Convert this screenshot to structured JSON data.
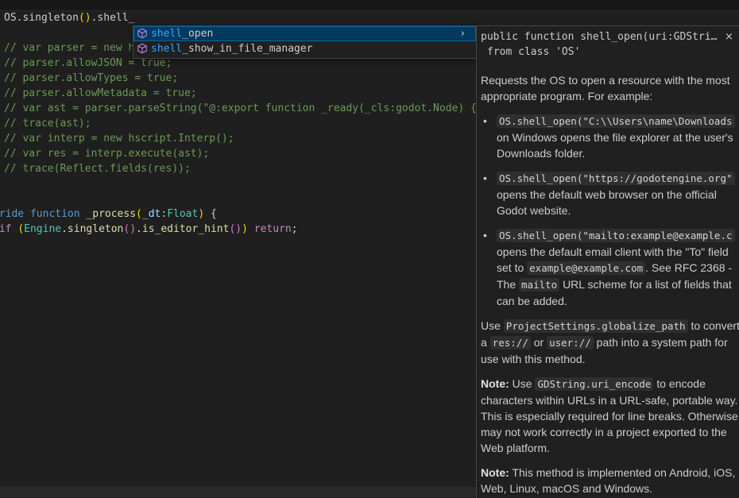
{
  "editor": {
    "lines": [
      [
        {
          "t": "OS",
          "c": "plain"
        },
        {
          "t": ".singleton",
          "c": "plain"
        },
        {
          "t": "()",
          "c": "p1"
        },
        {
          "t": ".shell_",
          "c": "plain"
        }
      ],
      [],
      [
        {
          "t": "// var parser = new h",
          "c": "cm"
        }
      ],
      [
        {
          "t": "// parser.allowJSON = true;",
          "c": "cm"
        }
      ],
      [
        {
          "t": "// parser.allowTypes = true;",
          "c": "cm"
        }
      ],
      [
        {
          "t": "// parser.allowMetadata = true;",
          "c": "cm"
        }
      ],
      [
        {
          "t": "// var ast = parser.parseString(\"@:export function _ready(_cls:godot.Node) {t",
          "c": "cm"
        }
      ],
      [
        {
          "t": "// trace(ast);",
          "c": "cm"
        }
      ],
      [
        {
          "t": "// var interp = new hscript.Interp();",
          "c": "cm"
        }
      ],
      [
        {
          "t": "// var res = interp.execute(ast);",
          "c": "cm"
        }
      ],
      [
        {
          "t": "// trace(Reflect.fields(res));",
          "c": "cm"
        }
      ],
      [],
      [],
      [
        {
          "t": "rride ",
          "c": "kw"
        },
        {
          "t": "function ",
          "c": "kw"
        },
        {
          "t": "_process",
          "c": "fn"
        },
        {
          "t": "(",
          "c": "p1"
        },
        {
          "t": "_dt",
          "c": "pm"
        },
        {
          "t": ":",
          "c": "plain"
        },
        {
          "t": "Float",
          "c": "ty"
        },
        {
          "t": ")",
          "c": "p1"
        },
        {
          "t": " {",
          "c": "plain"
        }
      ],
      [
        {
          "t": " if ",
          "c": "ctl"
        },
        {
          "t": "(",
          "c": "p1"
        },
        {
          "t": "Engine",
          "c": "ty"
        },
        {
          "t": ".singleton",
          "c": "fn"
        },
        {
          "t": "()",
          "c": "p2"
        },
        {
          "t": ".is_editor_hint",
          "c": "fn"
        },
        {
          "t": "()",
          "c": "p2"
        },
        {
          "t": ")",
          "c": "p1"
        },
        {
          "t": " return",
          "c": "ctl"
        },
        {
          "t": ";",
          "c": "plain"
        }
      ]
    ]
  },
  "suggest": {
    "items": [
      {
        "match": "shell",
        "rest": "_open",
        "icon": "cube-method-icon",
        "selected": true
      },
      {
        "match": "shell",
        "rest": "_show_in_file_manager",
        "icon": "cube-method-icon",
        "selected": false
      }
    ]
  },
  "doc": {
    "sig_line1": "public function shell_open(uri:GDStrin…",
    "sig_line2": "from class 'OS'",
    "close_glyph": "×",
    "p1": "Requests the OS to open a resource with the most appropriate program. For example:",
    "b1_code": "OS.shell_open(\"C:\\\\Users\\name\\Downloads",
    "b1_text": "on Windows opens the file explorer at the user's Downloads folder.",
    "b2_code": "OS.shell_open(\"https://godotengine.org\"",
    "b2_text": "opens the default web browser on the official Godot website.",
    "b3_code": "OS.shell_open(\"mailto:example@example.c",
    "b3_text1": "opens the default email client with the \"To\" field set to",
    "b3_code2": "example@example.com",
    "b3_text2": ". See RFC 2368 - The",
    "b3_code3": "mailto",
    "b3_text3": "URL scheme for a list of fields that can be added.",
    "p2_a": "Use",
    "p2_code1": "ProjectSettings.globalize_path",
    "p2_b": "to convert a",
    "p2_code2": "res://",
    "p2_c": "or",
    "p2_code3": "user://",
    "p2_d": "path into a system path for use with this method.",
    "note1_label": "Note:",
    "note1_a": "Use",
    "note1_code": "GDString.uri_encode",
    "note1_b": "to encode characters within URLs in a URL-safe, portable way. This is especially required for line breaks. Otherwise, may not work correctly in a project exported to the Web platform.",
    "note2_label": "Note:",
    "note2_text": "This method is implemented on Android, iOS, Web, Linux, macOS and Windows."
  }
}
